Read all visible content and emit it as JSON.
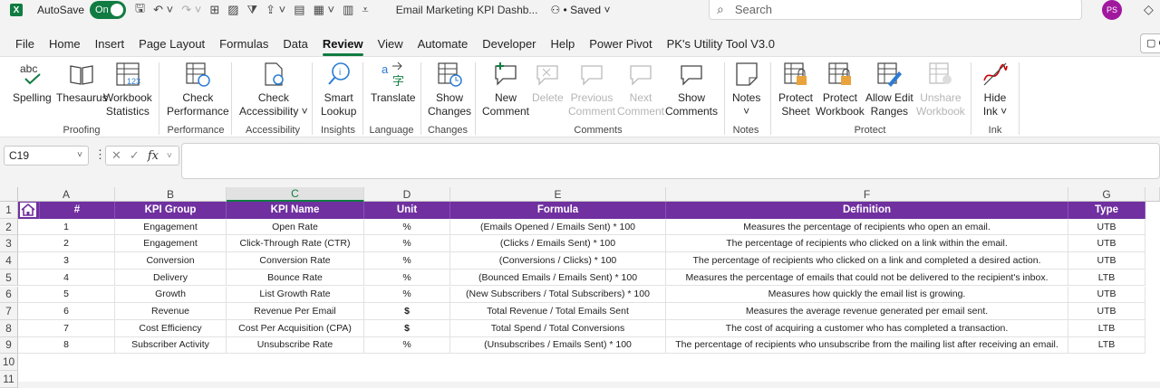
{
  "titlebar": {
    "app_logo": "X",
    "autosave_label": "AutoSave",
    "autosave_state": "On",
    "doc_title": "Email Marketing KPI Dashb...",
    "saved_status": "• Saved",
    "search_placeholder": "Search",
    "avatar_initials": "PS"
  },
  "tabs": [
    "File",
    "Home",
    "Insert",
    "Page Layout",
    "Formulas",
    "Data",
    "Review",
    "View",
    "Automate",
    "Developer",
    "Help",
    "Power Pivot",
    "PK's Utility Tool V3.0"
  ],
  "active_tab": "Review",
  "ribbon": {
    "spelling_icon_text": "abc",
    "spelling": "Spelling",
    "thesaurus": "Thesaurus",
    "workbook_stats": [
      "Workbook",
      "Statistics"
    ],
    "check_performance": [
      "Check",
      "Performance"
    ],
    "check_accessibility": [
      "Check",
      "Accessibility ˅"
    ],
    "smart_lookup": [
      "Smart",
      "Lookup"
    ],
    "translate": "Translate",
    "show_changes": [
      "Show",
      "Changes"
    ],
    "new_comment": [
      "New",
      "Comment"
    ],
    "delete": "Delete",
    "previous_comment": [
      "Previous",
      "Comment"
    ],
    "next_comment": [
      "Next",
      "Comment"
    ],
    "show_comments": [
      "Show",
      "Comments"
    ],
    "notes": "Notes",
    "protect_sheet": [
      "Protect",
      "Sheet"
    ],
    "protect_workbook": [
      "Protect",
      "Workbook"
    ],
    "allow_edit_ranges": [
      "Allow Edit",
      "Ranges"
    ],
    "unshare_workbook": [
      "Unshare",
      "Workbook"
    ],
    "hide_ink": [
      "Hide",
      "Ink ˅"
    ],
    "groups": {
      "proofing": "Proofing",
      "performance": "Performance",
      "accessibility": "Accessibility",
      "insights": "Insights",
      "language": "Language",
      "changes": "Changes",
      "comments": "Comments",
      "notes": "Notes",
      "protect": "Protect",
      "ink": "Ink"
    }
  },
  "formula_bar": {
    "name_box": "C19",
    "formula": ""
  },
  "grid": {
    "columns": [
      "A",
      "B",
      "C",
      "D",
      "E",
      "F",
      "G"
    ],
    "selected_column": "C",
    "rows": [
      "1",
      "2",
      "3",
      "4",
      "5",
      "6",
      "7",
      "8",
      "9",
      "10",
      "11"
    ],
    "header": [
      "#",
      "KPI Group",
      "KPI Name",
      "Unit",
      "Formula",
      "Definition",
      "Type"
    ],
    "data": [
      [
        "1",
        "Engagement",
        "Open Rate",
        "%",
        "(Emails Opened / Emails Sent) * 100",
        "Measures the percentage of recipients who open an email.",
        "UTB"
      ],
      [
        "2",
        "Engagement",
        "Click-Through Rate (CTR)",
        "%",
        "(Clicks / Emails Sent) * 100",
        "The percentage of recipients who clicked on a link within the email.",
        "UTB"
      ],
      [
        "3",
        "Conversion",
        "Conversion Rate",
        "%",
        "(Conversions / Clicks) * 100",
        "The percentage of recipients who clicked on a link and completed a desired action.",
        "UTB"
      ],
      [
        "4",
        "Delivery",
        "Bounce Rate",
        "%",
        "(Bounced Emails / Emails Sent) * 100",
        "Measures the percentage of emails that could not be delivered to the recipient's inbox.",
        "LTB"
      ],
      [
        "5",
        "Growth",
        "List Growth Rate",
        "%",
        "(New Subscribers / Total Subscribers) * 100",
        "Measures how quickly the email list is growing.",
        "UTB"
      ],
      [
        "6",
        "Revenue",
        "Revenue Per Email",
        "$",
        "Total Revenue / Total Emails Sent",
        "Measures the average revenue generated per email sent.",
        "UTB"
      ],
      [
        "7",
        "Cost Efficiency",
        "Cost Per Acquisition (CPA)",
        "$",
        "Total Spend / Total Conversions",
        "The cost of acquiring a customer who has completed a transaction.",
        "LTB"
      ],
      [
        "8",
        "Subscriber Activity",
        "Unsubscribe Rate",
        "%",
        "(Unsubscribes / Emails Sent) * 100",
        "The percentage of recipients who unsubscribe from the mailing list after receiving an email.",
        "LTB"
      ]
    ]
  },
  "colors": {
    "header_fill": "#7030a0",
    "excel_green": "#107c41"
  }
}
